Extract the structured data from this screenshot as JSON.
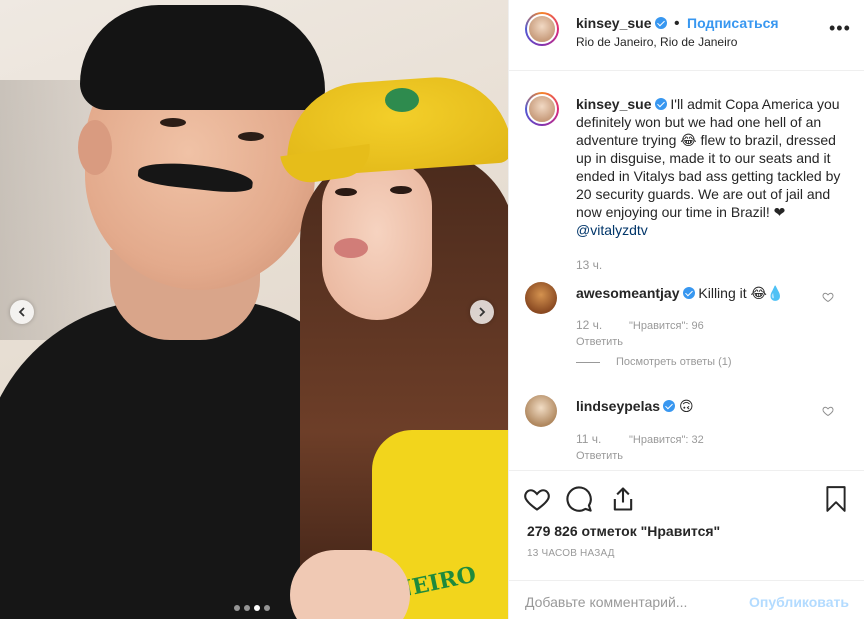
{
  "photo": {
    "shirt_text": "NEIRO",
    "carousel": {
      "total": 4,
      "active_index": 2
    }
  },
  "header": {
    "username": "kinsey_sue",
    "follow_label": "Подписаться",
    "location": "Rio de Janeiro, Rio de Janeiro",
    "more_icon": "ellipsis-icon"
  },
  "caption": {
    "username": "kinsey_sue",
    "text_before": "I'll admit Copa America you definitely won but we had one hell of an adventure trying 😂 flew to brazil, dressed up in disguise, made it to our seats and it ended in Vitalys bad ass getting tackled by 20 security guards. We are out of jail and now enjoying our time in Brazil! ❤ ",
    "mention": "@vitalyzdtv",
    "time": "13 ч."
  },
  "comments": [
    {
      "username": "awesomeantjay",
      "text": "Killing it 😂💧",
      "time": "12 ч.",
      "likes": "\"Нравится\": 96",
      "reply": "Ответить"
    },
    {
      "username": "lindseypelas",
      "text": "🙃",
      "time": "11 ч.",
      "likes": "\"Нравится\": 32",
      "reply": "Ответить"
    }
  ],
  "view_replies": "Посмотреть ответы (1)",
  "footer": {
    "likes": "279 826 отметок \"Нравится\"",
    "posted": "13 ЧАСОВ НАЗАД",
    "comment_placeholder": "Добавьте комментарий...",
    "publish_label": "Опубликовать"
  },
  "colors": {
    "accent": "#3897f0",
    "muted": "#999999",
    "publish_disabled": "#b3dbff"
  }
}
